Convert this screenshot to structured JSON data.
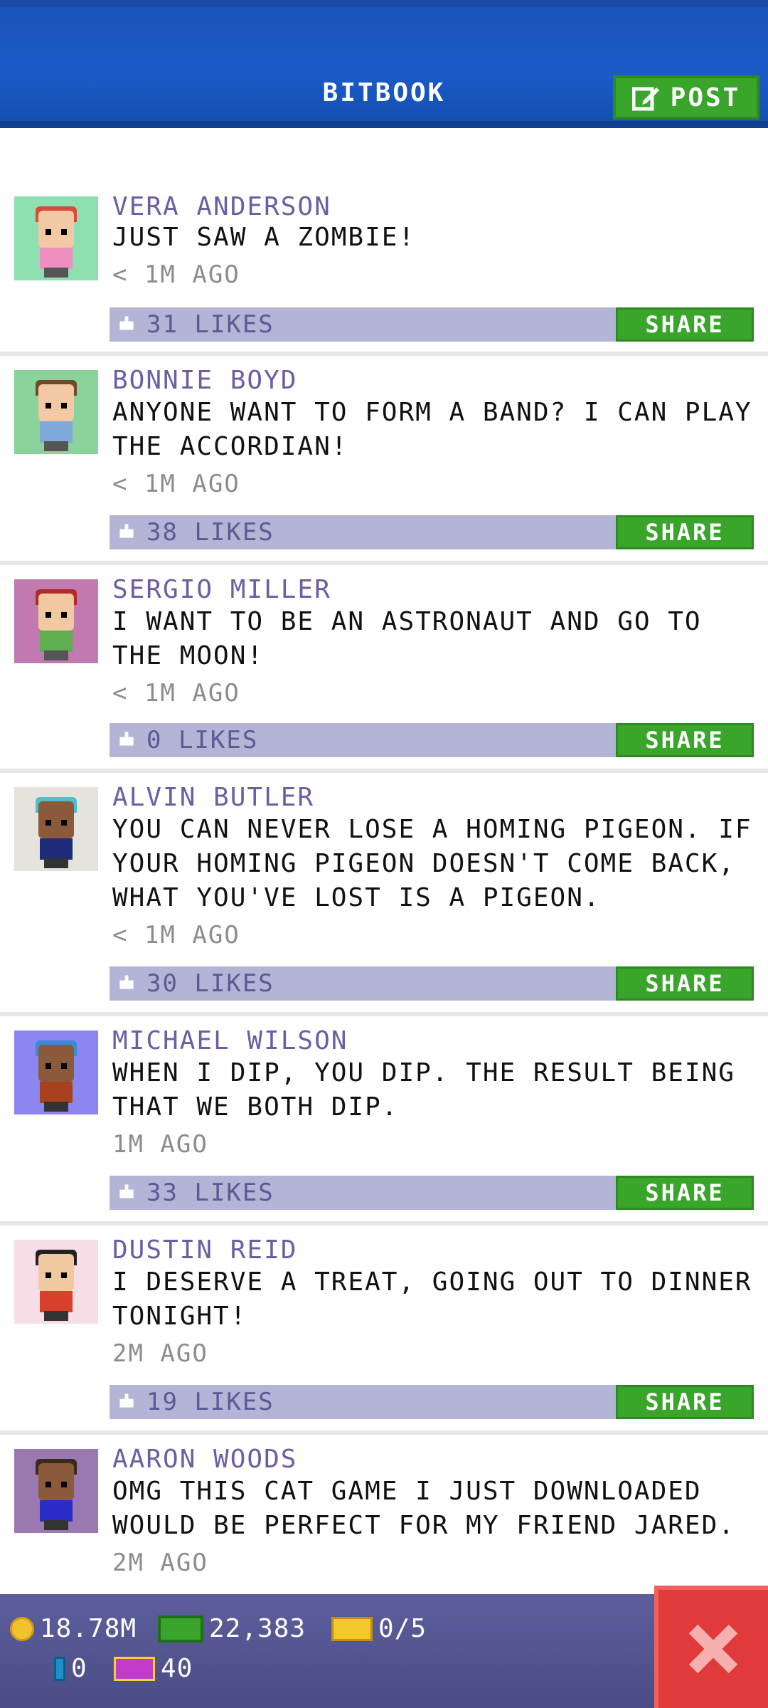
{
  "header": {
    "title": "BITBOOK",
    "post_label": "POST"
  },
  "posts": [
    {
      "name": "VERA ANDERSON",
      "message": "JUST SAW A ZOMBIE!",
      "time": "< 1M AGO",
      "likes": "31 LIKES",
      "share": "SHARE",
      "avatar_bg": "#8fe0b0",
      "hair": "#d9483a",
      "skin": "#f2c9a4",
      "shirt": "#ef8fc0"
    },
    {
      "name": "BONNIE BOYD",
      "message": "ANYONE WANT TO FORM A BAND? I CAN PLAY THE ACCORDIAN!",
      "time": "< 1M AGO",
      "likes": "38 LIKES",
      "share": "SHARE",
      "avatar_bg": "#8bd39a",
      "hair": "#6b4a2e",
      "skin": "#f2c9a4",
      "shirt": "#7fa9d8"
    },
    {
      "name": "SERGIO MILLER",
      "message": "I WANT TO BE AN ASTRONAUT AND GO TO THE MOON!",
      "time": "< 1M AGO",
      "likes": "0 LIKES",
      "share": "SHARE",
      "avatar_bg": "#c07ab0",
      "hair": "#b02a2a",
      "skin": "#f0c9a0",
      "shirt": "#5fae4f"
    },
    {
      "name": "ALVIN BUTLER",
      "message": "YOU CAN NEVER LOSE A HOMING PIGEON. IF YOUR HOMING PIGEON DOESN'T COME BACK, WHAT YOU'VE LOST IS A PIGEON.",
      "time": "< 1M AGO",
      "likes": "30 LIKES",
      "share": "SHARE",
      "avatar_bg": "#e6e2dc",
      "hair": "#4fc0c8",
      "skin": "#8a5a3a",
      "shirt": "#1f2c7a"
    },
    {
      "name": "MICHAEL WILSON",
      "message": "WHEN I DIP, YOU DIP. THE RESULT BEING THAT WE BOTH DIP.",
      "time": "1M AGO",
      "likes": "33 LIKES",
      "share": "SHARE",
      "avatar_bg": "#8c86f0",
      "hair": "#3a8ad8",
      "skin": "#8a5a3a",
      "shirt": "#a8421e"
    },
    {
      "name": "DUSTIN REID",
      "message": "I DESERVE A TREAT, GOING OUT TO DINNER TONIGHT!",
      "time": "2M AGO",
      "likes": "19 LIKES",
      "share": "SHARE",
      "avatar_bg": "#f7dde6",
      "hair": "#222222",
      "skin": "#f0c9a0",
      "shirt": "#d8402c"
    },
    {
      "name": "AARON WOODS",
      "message": "OMG THIS CAT GAME I JUST DOWNLOADED WOULD BE PERFECT FOR MY FRIEND JARED.",
      "time": "2M AGO",
      "likes": "",
      "share": "",
      "avatar_bg": "#9a78b0",
      "hair": "#3a2a1a",
      "skin": "#8a5a3a",
      "shirt": "#2c2cc8"
    }
  ],
  "status": {
    "coins": "18.78M",
    "bux_cash": "22,383",
    "tickets": "0/5",
    "gems": "0",
    "vip": "40"
  },
  "icons": {
    "post": "edit-icon",
    "close": "close-icon",
    "like": "thumbs-up-icon"
  },
  "colors": {
    "header": "#1a5ac7",
    "accent_green": "#3aa52b",
    "likes_bar": "#b4b4d6",
    "name": "#6a5fa3",
    "close": "#e03a3a"
  }
}
